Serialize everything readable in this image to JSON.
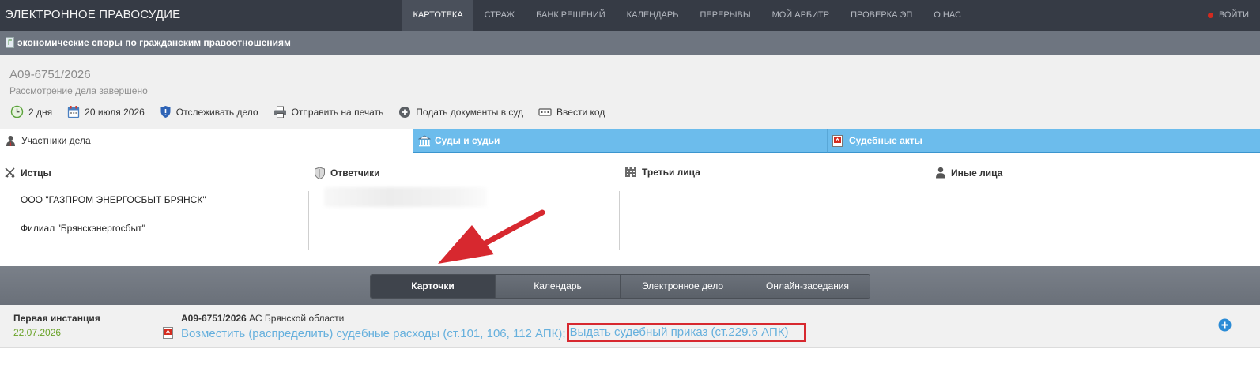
{
  "topbar": {
    "brand": "ЭЛЕКТРОННОЕ ПРАВОСУДИЕ",
    "nav": [
      {
        "label": "КАРТОТЕКА",
        "active": true
      },
      {
        "label": "СТРАЖ"
      },
      {
        "label": "БАНК РЕШЕНИЙ"
      },
      {
        "label": "КАЛЕНДАРЬ"
      },
      {
        "label": "ПЕРЕРЫВЫ"
      },
      {
        "label": "МОЙ АРБИТР"
      },
      {
        "label": "ПРОВЕРКА ЭП"
      },
      {
        "label": "О НАС"
      }
    ],
    "login": "ВОЙТИ"
  },
  "category": {
    "label": "экономические споры по гражданским правоотношениям"
  },
  "case": {
    "number": "А09-6751/2026",
    "status": "Рассмотрение дела завершено",
    "actions": [
      {
        "label": "2 дня",
        "icon": "clock-icon"
      },
      {
        "label": "20 июля 2026",
        "icon": "calendar-icon"
      },
      {
        "label": "Отслеживать дело",
        "icon": "shield-icon"
      },
      {
        "label": "Отправить на печать",
        "icon": "printer-icon"
      },
      {
        "label": "Подать документы в суд",
        "icon": "plus-circle-icon"
      },
      {
        "label": "Ввести код",
        "icon": "code-icon"
      }
    ]
  },
  "tabs": {
    "participants": "Участники дела",
    "courts": "Суды и судьи",
    "acts": "Судебные акты"
  },
  "participants": {
    "plaintiffs": {
      "title": "Истцы",
      "items": [
        "ООО \"ГАЗПРОМ ЭНЕРГОСБЫТ БРЯНСК\"",
        "Филиал \"Брянскэнергосбыт\""
      ]
    },
    "defendants": {
      "title": "Ответчики"
    },
    "third_parties": {
      "title": "Третьи лица"
    },
    "others": {
      "title": "Иные лица"
    }
  },
  "views": {
    "cards": "Карточки",
    "calendar": "Календарь",
    "electronic_case": "Электронное дело",
    "online": "Онлайн-заседания"
  },
  "instance": {
    "title": "Первая инстанция",
    "date": "22.07.2026",
    "case_number": "А09-6751/2026",
    "court": "АС Брянской области",
    "link1": "Возместить (распределить) судебные расходы (ст.101, 106, 112 АПК);",
    "link2": "Выдать судебный приказ (ст.229.6 АПК)"
  },
  "colors": {
    "topbar": "#363b45",
    "category_bar": "#6e7580",
    "tab_blue": "#6cbcec",
    "link": "#66b0dd",
    "date_green": "#6aa329",
    "highlight_red": "#d7282f"
  }
}
